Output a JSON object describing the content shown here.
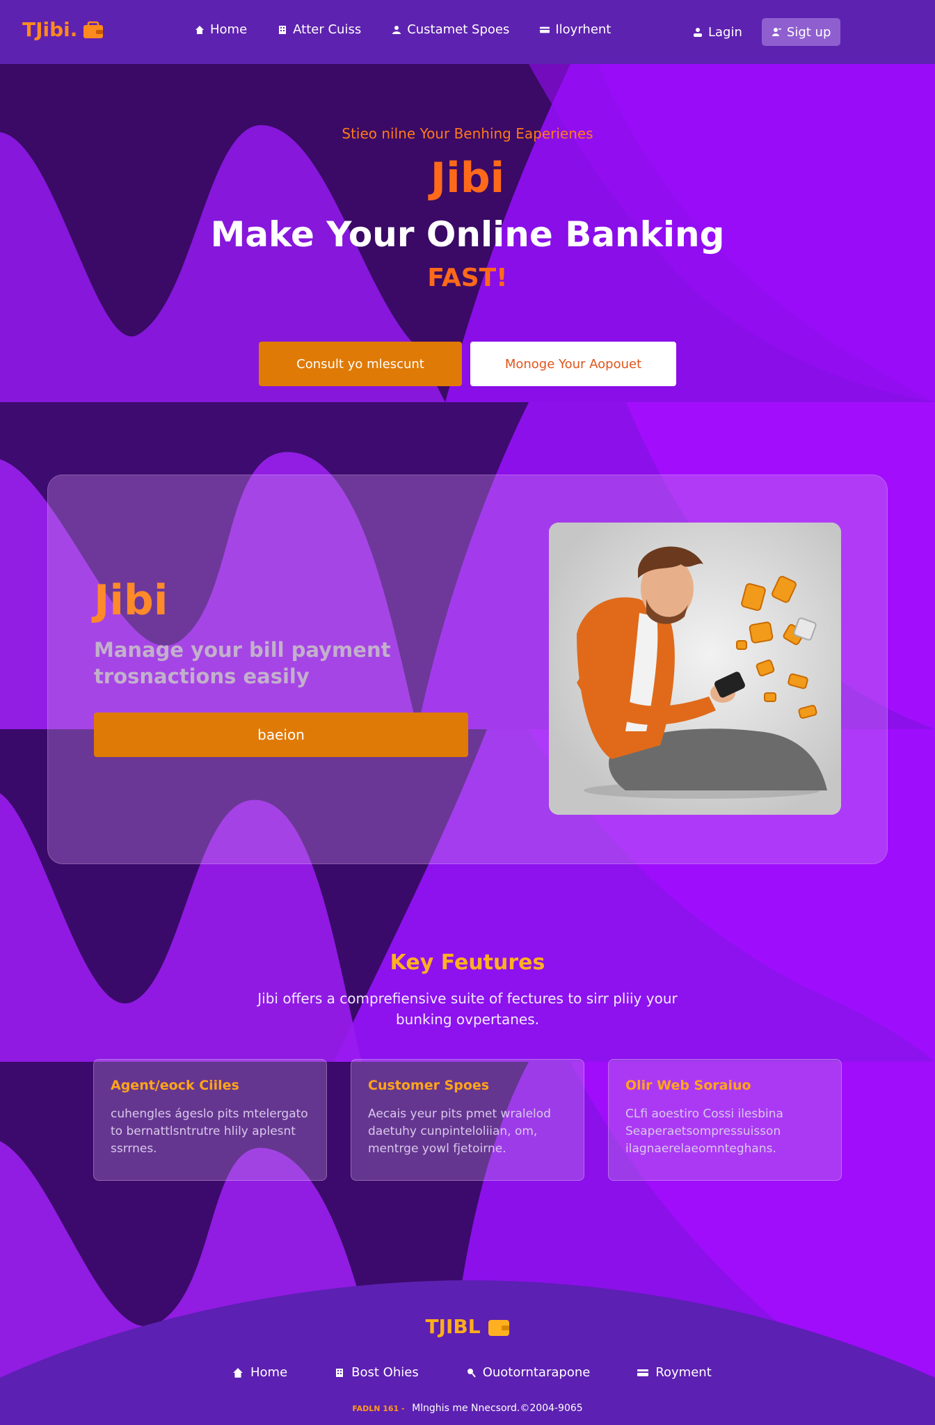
{
  "nav": {
    "brand": "TJibi.",
    "links": [
      {
        "label": "Home",
        "icon": "home-icon"
      },
      {
        "label": "Atter Cuiss",
        "icon": "building-icon"
      },
      {
        "label": "Custamet Spoes",
        "icon": "user-group-icon"
      },
      {
        "label": "Iloyrhent",
        "icon": "card-icon"
      }
    ],
    "login": "Lagin",
    "signup": "Sigt up"
  },
  "hero": {
    "tagline": "Stieo nilne Your Benhing Eaperienes",
    "brand": "Jibi",
    "title": "Make Your Online Banking",
    "accent": "FAST!",
    "primary_button": "Consult yo mlescunt",
    "secondary_button": "Monoge Your Aopouet"
  },
  "promo": {
    "brand": "Jibi",
    "text": "Manage your bill payment trosnactions easily",
    "button": "baeion"
  },
  "features": {
    "title": "Key Feutures",
    "description": "Jibi offers a comprefiensive suite of fectures to sirr pliiy your bunking ovpertanes.",
    "cards": [
      {
        "title": "Agent/eock Ciiles",
        "text": "cuhengles ágeslo pits mtelergato to bernattlsntrutre hlily aplesnt ssrrnes."
      },
      {
        "title": "Customer Spoes",
        "text": "Aecais yeur pits pmet wralelod daetuhy cunpinteloliian, om, mentrge yowl fjetoirne."
      },
      {
        "title": "Olir Web Soraiuo",
        "text": "CLfi aoestiro Cossi ilesbina Seaperaetsompressuisson ilagnaerelaeomnteghans."
      }
    ]
  },
  "footer": {
    "brand": "TJIBL",
    "links": [
      {
        "label": "Home",
        "icon": "home-icon"
      },
      {
        "label": "Bost Ohies",
        "icon": "building-icon"
      },
      {
        "label": "Ouotorntarapone",
        "icon": "support-icon"
      },
      {
        "label": "Royment",
        "icon": "card-icon"
      }
    ],
    "copyright_highlight": "FADLN 161 -",
    "copyright": "Mlnghis me Nnecsord.©2004-9065"
  },
  "colors": {
    "accent_orange": "#e07a06",
    "brand_orange": "#ff6a1a",
    "nav_purple": "#5e22b0",
    "bg_purple": "#8b12f0"
  }
}
